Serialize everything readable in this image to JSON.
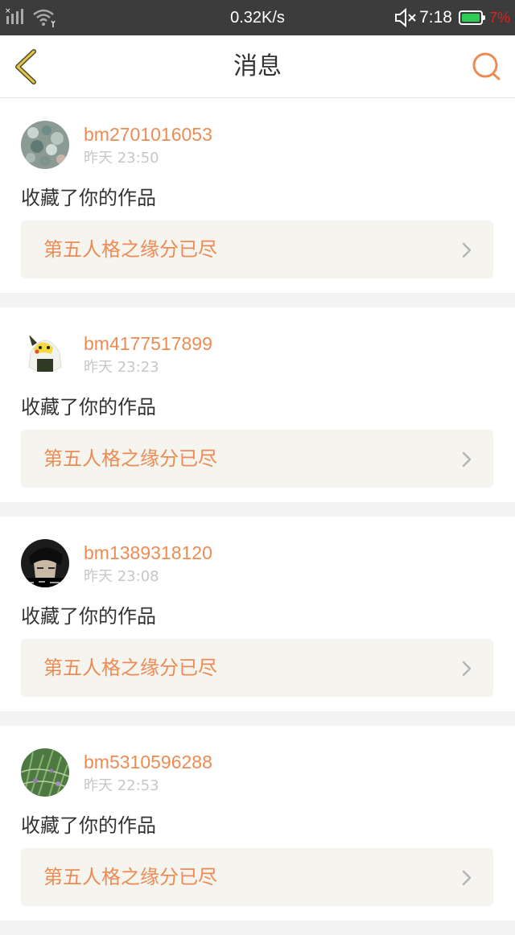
{
  "status_bar": {
    "network_speed": "0.32K/s",
    "time": "7:18",
    "battery_percent": "7%",
    "battery_color": "#2ecc55"
  },
  "header": {
    "title": "消息",
    "back_icon": "back-arrow-icon",
    "search_icon": "search-icon",
    "accent_color": "#ec8c54"
  },
  "messages": [
    {
      "username": "bm2701016053",
      "time": "昨天 23:50",
      "action": "收藏了你的作品",
      "work_title": "第五人格之缘分已尽"
    },
    {
      "username": "bm4177517899",
      "time": "昨天 23:23",
      "action": "收藏了你的作品",
      "work_title": "第五人格之缘分已尽"
    },
    {
      "username": "bm1389318120",
      "time": "昨天 23:08",
      "action": "收藏了你的作品",
      "work_title": "第五人格之缘分已尽"
    },
    {
      "username": "bm5310596288",
      "time": "昨天 22:53",
      "action": "收藏了你的作品",
      "work_title": "第五人格之缘分已尽"
    }
  ]
}
